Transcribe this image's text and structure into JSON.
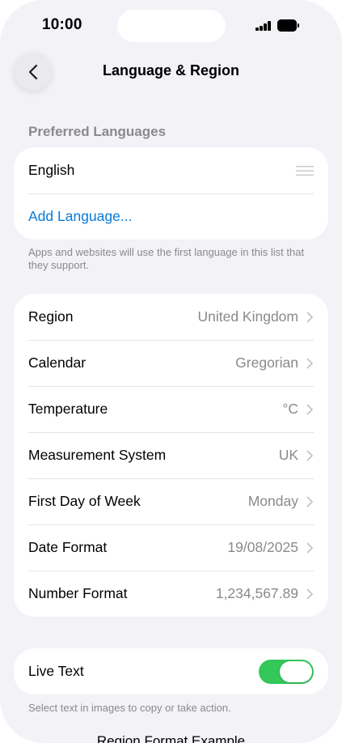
{
  "status_bar": {
    "time": "10:00"
  },
  "nav": {
    "title": "Language & Region"
  },
  "preferred_languages": {
    "header": "Preferred Languages",
    "languages": [
      {
        "label": "English"
      }
    ],
    "add_language_label": "Add Language...",
    "footnote": "Apps and websites will use the first language in this list that they support."
  },
  "region_settings": {
    "rows": [
      {
        "label": "Region",
        "value": "United Kingdom"
      },
      {
        "label": "Calendar",
        "value": "Gregorian"
      },
      {
        "label": "Temperature",
        "value": "°C"
      },
      {
        "label": "Measurement System",
        "value": "UK"
      },
      {
        "label": "First Day of Week",
        "value": "Monday"
      },
      {
        "label": "Date Format",
        "value": "19/08/2025"
      },
      {
        "label": "Number Format",
        "value": "1,234,567.89"
      }
    ]
  },
  "live_text": {
    "label": "Live Text",
    "enabled": true,
    "footnote": "Select text in images to copy or take action."
  },
  "region_format_example": {
    "header": "Region Format Example"
  },
  "colors": {
    "accent": "#0a7ad6",
    "toggle_on": "#34c759",
    "secondary_text": "#8a8a8e",
    "background": "#f2f2f7"
  },
  "icons": {
    "back": "chevron-left-icon",
    "reorder": "drag-handle-icon",
    "disclosure": "chevron-right-icon"
  }
}
